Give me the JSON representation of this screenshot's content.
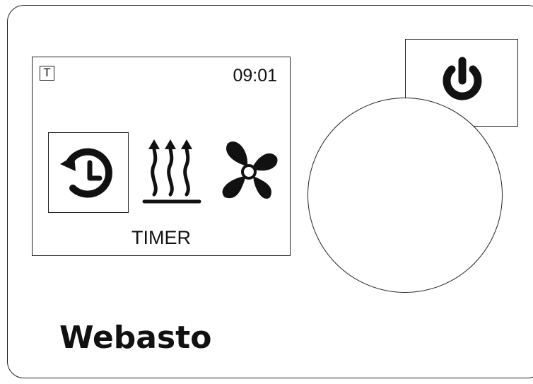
{
  "display": {
    "mode_badge": "T",
    "time": "09:01",
    "mode_label": "TIMER",
    "icons": [
      "timer-icon",
      "heating-icon",
      "ventilation-fan-icon"
    ],
    "selected_icon": "timer-icon"
  },
  "controls": {
    "power_icon": "power-icon",
    "knob": "rotary-knob"
  },
  "brand": {
    "name": "Webasto"
  },
  "colors": {
    "ink": "#111111",
    "background": "#ffffff"
  }
}
